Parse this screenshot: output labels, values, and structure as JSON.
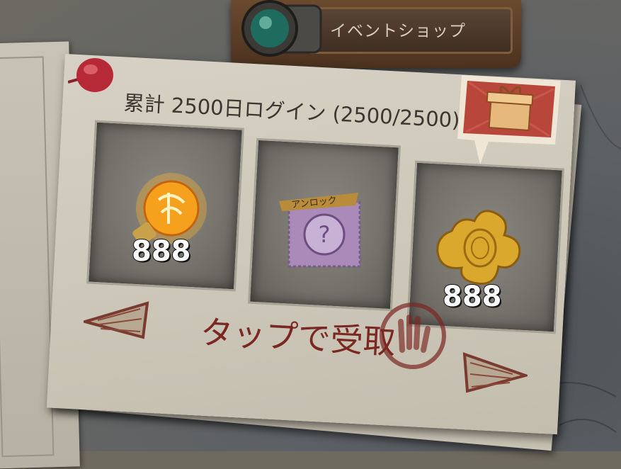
{
  "shop": {
    "label": "イベントショップ"
  },
  "login_card": {
    "title": "累計 2500日ログイン (2500/2500)",
    "rewards": [
      {
        "item": "golden-bulb",
        "count": "888"
      },
      {
        "item": "mystery-stamp",
        "badge": "アンロック",
        "count": ""
      },
      {
        "item": "golden-puzzle-piece",
        "count": "888"
      }
    ],
    "claim_label": "タップで受取"
  },
  "colors": {
    "claim_text": "#7b2722",
    "gift_badge": "#b8463b",
    "shop_button": "#5a3d27"
  }
}
